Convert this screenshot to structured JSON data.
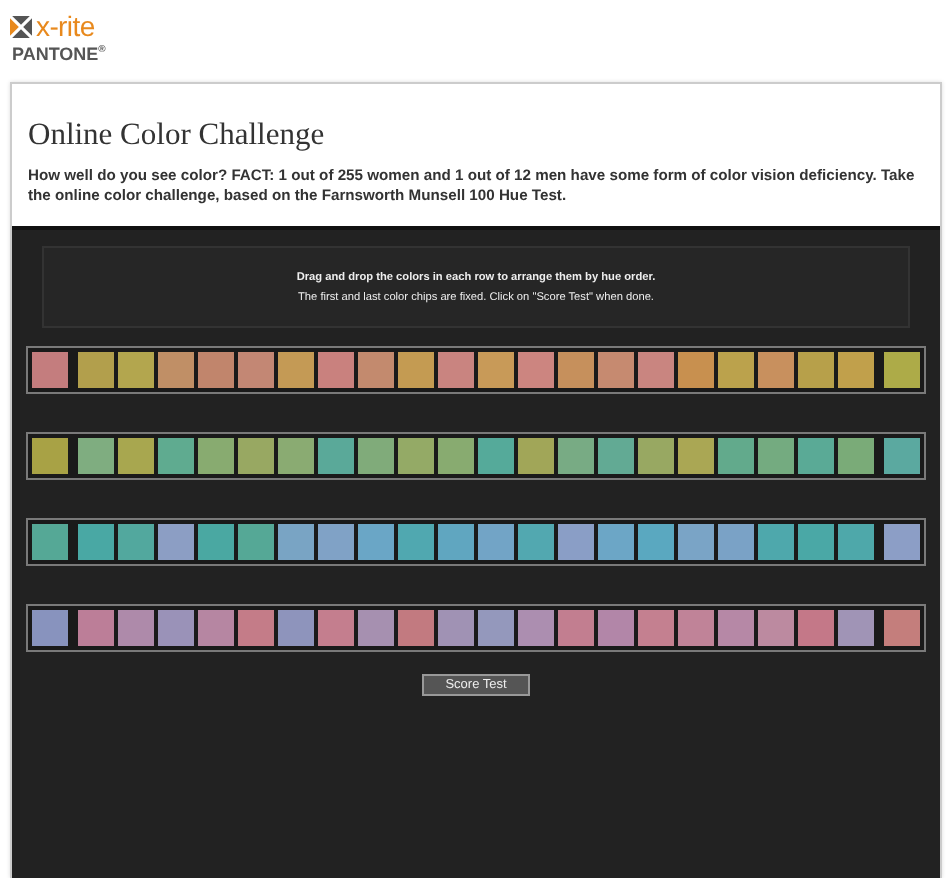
{
  "brand": {
    "logo_text": "x-rite",
    "sub_brand": "PANTONE$^{®}$"
  },
  "challenge": {
    "title": "Online Color Challenge",
    "description": "How well do you see color? FACT: 1 out of 255 women and 1 out of 12 men have some form of color vision deficiency. Take the online color challenge, based on the Farnsworth Munsell 100 Hue Test.",
    "instructions": [
      "Drag and drop the colors in each row to arrange them by hue order.",
      "The first and last color chips are fixed. Click on \"Score Test\" when done."
    ],
    "rows": [
      {
        "first": {
          "color": "#c47d7e"
        },
        "last": {
          "color": "#adab48"
        },
        "chips": [
          {
            "color": "#b29f4c"
          },
          {
            "color": "#b3a64e"
          },
          {
            "color": "#c08f66"
          },
          {
            "color": "#c1856c"
          },
          {
            "color": "#c38774"
          },
          {
            "color": "#c49a55"
          },
          {
            "color": "#c9817e"
          },
          {
            "color": "#c38a6e"
          },
          {
            "color": "#c49b52"
          },
          {
            "color": "#c98480"
          },
          {
            "color": "#c89a58"
          },
          {
            "color": "#cc8580"
          },
          {
            "color": "#c6905c"
          },
          {
            "color": "#c68a70"
          },
          {
            "color": "#c98580"
          },
          {
            "color": "#c8904f"
          },
          {
            "color": "#bba24c"
          },
          {
            "color": "#c8905e"
          },
          {
            "color": "#b7a04a"
          },
          {
            "color": "#c1a04b"
          }
        ]
      },
      {
        "first": {
          "color": "#a8a245"
        },
        "last": {
          "color": "#5ba9a0"
        },
        "chips": [
          {
            "color": "#7fad80"
          },
          {
            "color": "#a8a74f"
          },
          {
            "color": "#5fab90"
          },
          {
            "color": "#88ab70"
          },
          {
            "color": "#98a862"
          },
          {
            "color": "#8aab72"
          },
          {
            "color": "#5aa999"
          },
          {
            "color": "#80ab7a"
          },
          {
            "color": "#94aa66"
          },
          {
            "color": "#88ab70"
          },
          {
            "color": "#55aa9a"
          },
          {
            "color": "#a1a658"
          },
          {
            "color": "#78ab84"
          },
          {
            "color": "#62aa94"
          },
          {
            "color": "#98a862"
          },
          {
            "color": "#aaa754"
          },
          {
            "color": "#62aa8c"
          },
          {
            "color": "#74ab80"
          },
          {
            "color": "#5aaa96"
          },
          {
            "color": "#7aab78"
          }
        ]
      },
      {
        "first": {
          "color": "#55a896"
        },
        "last": {
          "color": "#8c9ec6"
        },
        "chips": [
          {
            "color": "#49a8a4"
          },
          {
            "color": "#52a89e"
          },
          {
            "color": "#8c9ec4"
          },
          {
            "color": "#4aa8a2"
          },
          {
            "color": "#55a896"
          },
          {
            "color": "#79a4c4"
          },
          {
            "color": "#80a2c6"
          },
          {
            "color": "#6aa6c6"
          },
          {
            "color": "#50a8b0"
          },
          {
            "color": "#60a6c0"
          },
          {
            "color": "#72a4c6"
          },
          {
            "color": "#52a8b0"
          },
          {
            "color": "#8a9ec6"
          },
          {
            "color": "#6ca6c6"
          },
          {
            "color": "#5aa8c0"
          },
          {
            "color": "#7aa4c6"
          },
          {
            "color": "#7aa2c6"
          },
          {
            "color": "#4ea8ac"
          },
          {
            "color": "#4aa8a6"
          },
          {
            "color": "#4ea8aa"
          }
        ]
      },
      {
        "first": {
          "color": "#8893be"
        },
        "last": {
          "color": "#c47e7c"
        },
        "chips": [
          {
            "color": "#bc7e98"
          },
          {
            "color": "#ae8aaa"
          },
          {
            "color": "#9a92b8"
          },
          {
            "color": "#b686a2"
          },
          {
            "color": "#c47c88"
          },
          {
            "color": "#8e94bc"
          },
          {
            "color": "#c47e8e"
          },
          {
            "color": "#a690b0"
          },
          {
            "color": "#c27a80"
          },
          {
            "color": "#a092b4"
          },
          {
            "color": "#9498bc"
          },
          {
            "color": "#ac8eb0"
          },
          {
            "color": "#c27e90"
          },
          {
            "color": "#b286a8"
          },
          {
            "color": "#c48090"
          },
          {
            "color": "#c08398"
          },
          {
            "color": "#b688a6"
          },
          {
            "color": "#bc8aa0"
          },
          {
            "color": "#c47888"
          },
          {
            "color": "#a094b6"
          }
        ]
      }
    ],
    "button": "Score Test"
  }
}
